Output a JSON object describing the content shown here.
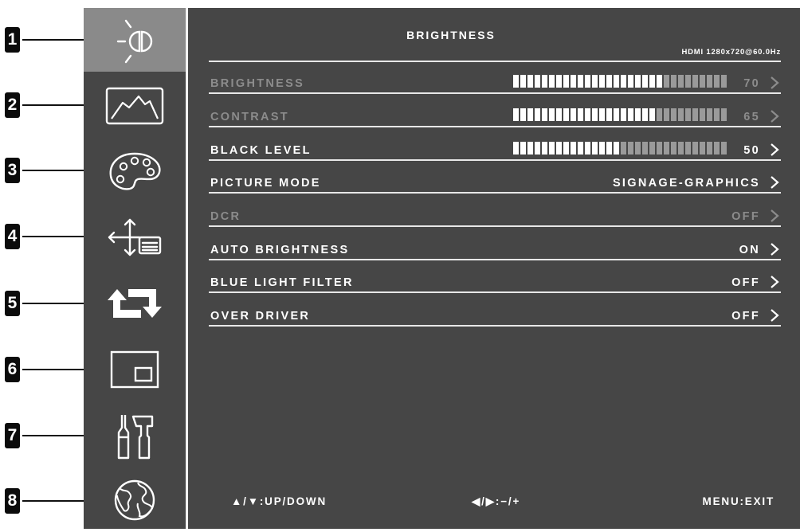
{
  "callouts": [
    "1",
    "2",
    "3",
    "4",
    "5",
    "6",
    "7",
    "8"
  ],
  "sidebar": {
    "items": [
      {
        "icon": "brightness-icon",
        "active": true
      },
      {
        "icon": "picture-mountain-icon",
        "active": false
      },
      {
        "icon": "color-palette-icon",
        "active": false
      },
      {
        "icon": "position-arrows-icon",
        "active": false
      },
      {
        "icon": "rotate-arrows-icon",
        "active": false
      },
      {
        "icon": "pip-window-icon",
        "active": false
      },
      {
        "icon": "tools-icon",
        "active": false
      },
      {
        "icon": "globe-icon",
        "active": false
      }
    ]
  },
  "panel": {
    "title": "BRIGHTNESS",
    "signal": "HDMI 1280x720@60.0Hz",
    "rows": [
      {
        "label": "BRIGHTNESS",
        "value": "70",
        "level": 70,
        "dimmed": true
      },
      {
        "label": "CONTRAST",
        "value": "65",
        "level": 65,
        "dimmed": true
      },
      {
        "label": "BLACK LEVEL",
        "value": "50",
        "level": 50,
        "dimmed": false
      },
      {
        "label": "PICTURE MODE",
        "value": "SIGNAGE-GRAPHICS",
        "dimmed": false
      },
      {
        "label": "DCR",
        "value": "OFF",
        "dimmed": true
      },
      {
        "label": "AUTO BRIGHTNESS",
        "value": "ON",
        "dimmed": false
      },
      {
        "label": "BLUE LIGHT FILTER",
        "value": "OFF",
        "dimmed": false
      },
      {
        "label": "OVER DRIVER",
        "value": "OFF",
        "dimmed": false
      }
    ]
  },
  "footer": {
    "up_down": "▲/▼:UP/DOWN",
    "minus_plus": "◀/▶:−/+",
    "exit": "MENU:EXIT"
  },
  "colors": {
    "panel_bg": "#464646",
    "active_item_bg": "#8a8a8a",
    "text": "#ffffff",
    "dimmed_text": "#8c8c8c",
    "bar_filled": "#ffffff",
    "bar_empty": "#9a9a9a"
  }
}
